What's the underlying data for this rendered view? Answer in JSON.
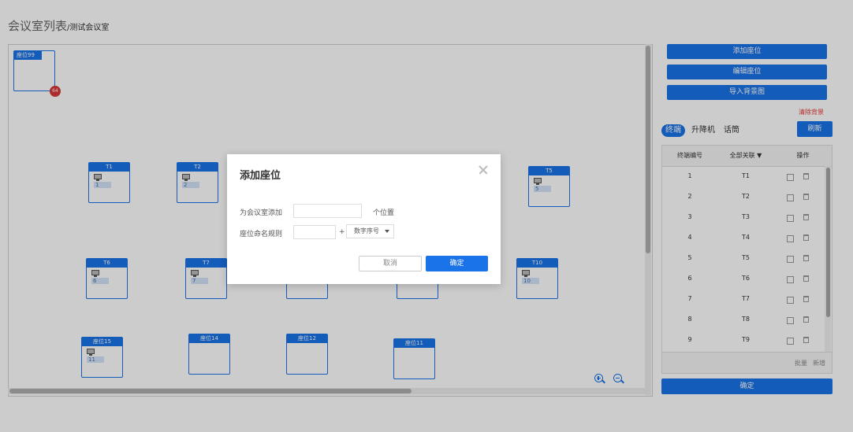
{
  "header": {
    "title": "会议室列表",
    "subtitle": "/测试会议室"
  },
  "canvas": {
    "seats": [
      {
        "id": "s99",
        "label": "座位99",
        "badge": "64"
      },
      {
        "id": "t1",
        "label": "T1",
        "num": "1",
        "has_terminal": true
      },
      {
        "id": "t2",
        "label": "T2",
        "num": "2",
        "has_terminal": true
      },
      {
        "id": "t5",
        "label": "T5",
        "num": "5",
        "has_terminal": true
      },
      {
        "id": "t6",
        "label": "T6",
        "num": "6",
        "has_terminal": true
      },
      {
        "id": "t7",
        "label": "T7",
        "num": "7",
        "has_terminal": true
      },
      {
        "id": "t10",
        "label": "T10",
        "num": "10",
        "has_terminal": true
      },
      {
        "id": "s15",
        "label": "座位15",
        "num": "11",
        "has_terminal": true
      },
      {
        "id": "s14",
        "label": "座位14"
      },
      {
        "id": "s12",
        "label": "座位12"
      },
      {
        "id": "s11",
        "label": "座位11"
      }
    ],
    "zoom_in_icon": "zoom-in-icon",
    "zoom_out_icon": "zoom-out-icon"
  },
  "sidebar": {
    "add_seat": "添加座位",
    "edit_seat": "编辑座位",
    "import_bg": "导入背景图",
    "clear_bg": "清除背景",
    "tabs": [
      "终端",
      "升降机",
      "话筒"
    ],
    "active_tab": "终端",
    "refresh": "刷新",
    "table": {
      "headers": [
        "终端编号",
        "全部关联 ▼",
        "操作"
      ],
      "rows": [
        [
          "1",
          "T1"
        ],
        [
          "2",
          "T2"
        ],
        [
          "3",
          "T3"
        ],
        [
          "4",
          "T4"
        ],
        [
          "5",
          "T5"
        ],
        [
          "6",
          "T6"
        ],
        [
          "7",
          "T7"
        ],
        [
          "8",
          "T8"
        ],
        [
          "9",
          "T9"
        ]
      ],
      "footer_batch": "批量",
      "footer_add": "新增"
    },
    "confirm": "确定"
  },
  "modal": {
    "title": "添加座位",
    "row1_label": "为会议室添加",
    "row1_value": "",
    "row1_suffix": "个位置",
    "row2_label": "座位命名规则",
    "row2_value": "",
    "row2_plus": "+",
    "row2_select": "数字序号",
    "cancel": "取消",
    "ok": "确定"
  },
  "colors": {
    "accent": "#1a73e8",
    "danger": "#e53935",
    "badge": "#d9383a"
  }
}
